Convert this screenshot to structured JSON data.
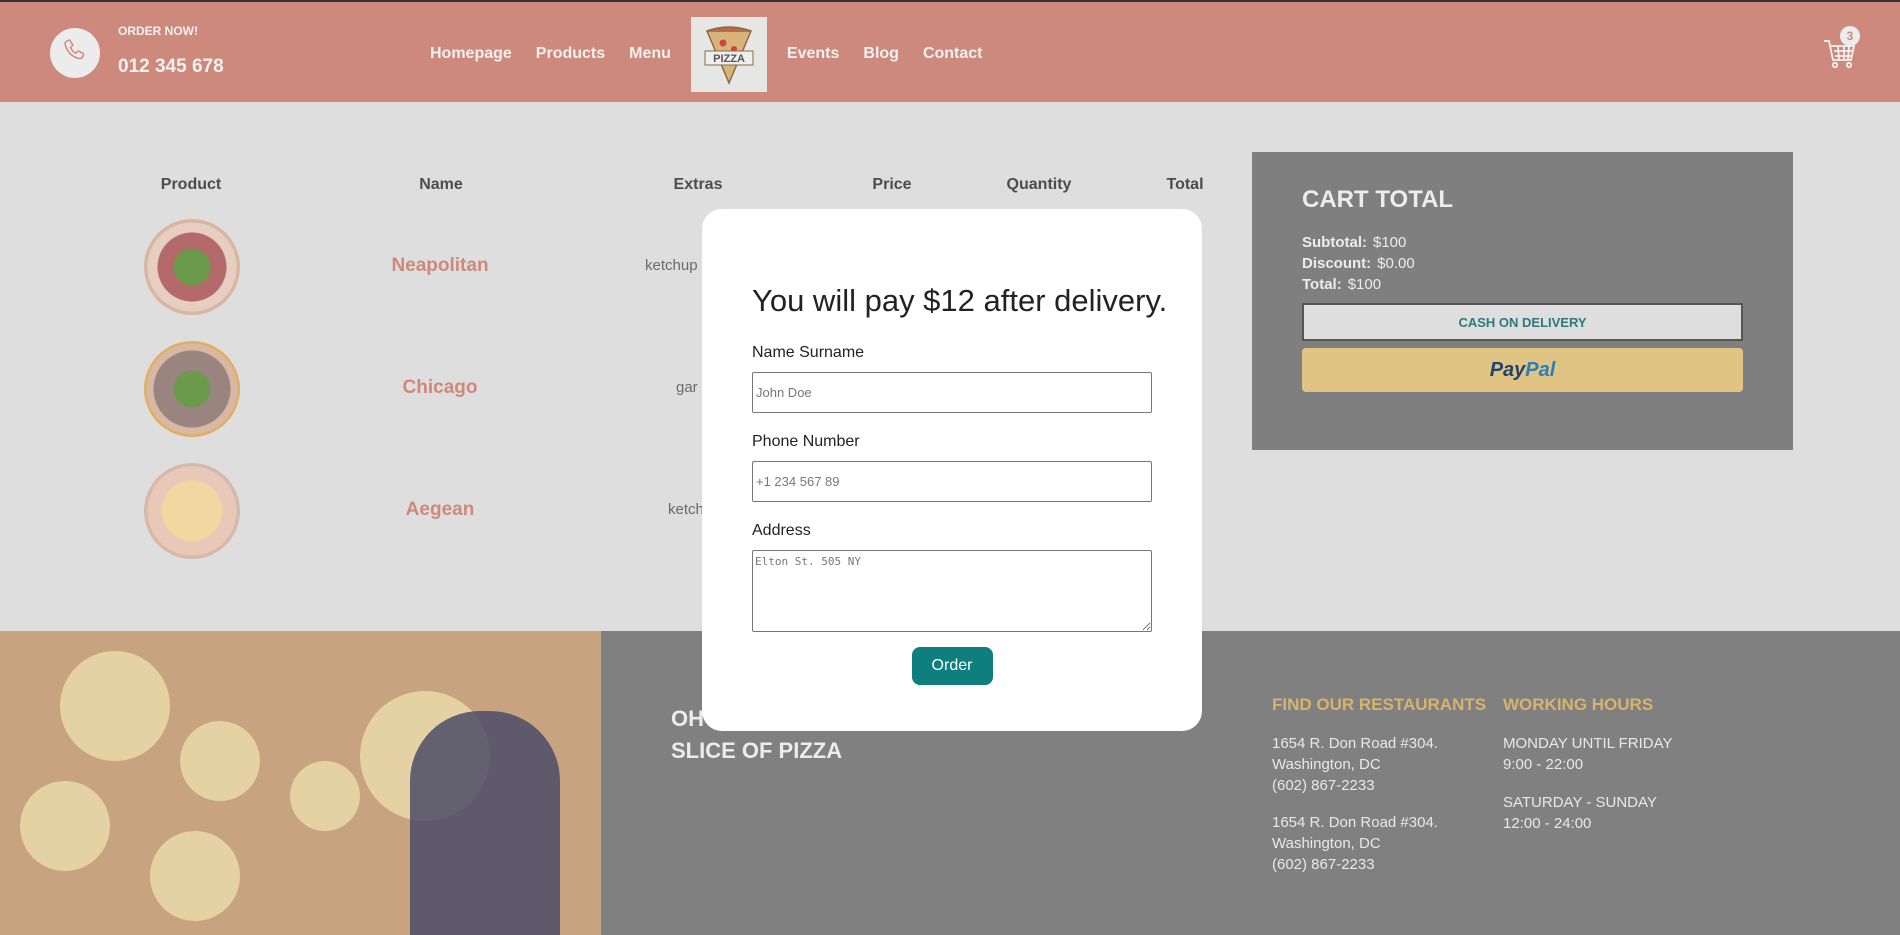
{
  "header": {
    "order_label": "ORDER NOW!",
    "phone": "012 345 678",
    "nav_items": [
      "Homepage",
      "Products",
      "Menu",
      "Events",
      "Blog",
      "Contact"
    ],
    "logo_text": "PIZZA",
    "cart_count": "3"
  },
  "table": {
    "headers": [
      "Product",
      "Name",
      "Extras",
      "Price",
      "Quantity",
      "Total"
    ],
    "rows": [
      {
        "name": "Neapolitan",
        "extras": "ketchup"
      },
      {
        "name": "Chicago",
        "extras": "gar"
      },
      {
        "name": "Aegean",
        "extras": "ketch"
      }
    ]
  },
  "cart_total": {
    "title": "CART TOTAL",
    "subtotal_label": "Subtotal:",
    "subtotal_value": "$100",
    "discount_label": "Discount:",
    "discount_value": "$0.00",
    "total_label": "Total:",
    "total_value": "$100",
    "cod_label": "CASH ON DELIVERY",
    "paypal_part1": "Pay",
    "paypal_part2": "Pal"
  },
  "modal": {
    "title": "You will pay $12 after delivery.",
    "name_label": "Name Surname",
    "name_placeholder": "John Doe",
    "phone_label": "Phone Number",
    "phone_placeholder": "+1 234 567 89",
    "address_label": "Address",
    "address_placeholder": "Elton St. 505 NY",
    "order_label": "Order"
  },
  "footer": {
    "slogan_line1": "OH",
    "slogan_line2": "SLICE OF PIZZA",
    "restaurants_title": "FIND OUR RESTAURANTS",
    "restaurants": [
      {
        "street": "1654 R. Don Road #304.",
        "city": "Washington, DC",
        "phone": "(602) 867-2233"
      },
      {
        "street": "1654 R. Don Road #304.",
        "city": "Washington, DC",
        "phone": "(602) 867-2233"
      }
    ],
    "hours_title": "WORKING HOURS",
    "hours": [
      {
        "days": "MONDAY UNTIL FRIDAY",
        "time": "9:00 - 22:00"
      },
      {
        "days": "SATURDAY - SUNDAY",
        "time": "12:00 - 24:00"
      }
    ]
  },
  "colors": {
    "navbar": "#cd8a7c",
    "accent_teal": "#0e7f7e",
    "footer": "#808080",
    "footer_heading": "#d6b36e",
    "paypal_button": "#e0c484"
  },
  "icons": [
    "phone-icon",
    "pizza-logo",
    "cart-icon"
  ]
}
